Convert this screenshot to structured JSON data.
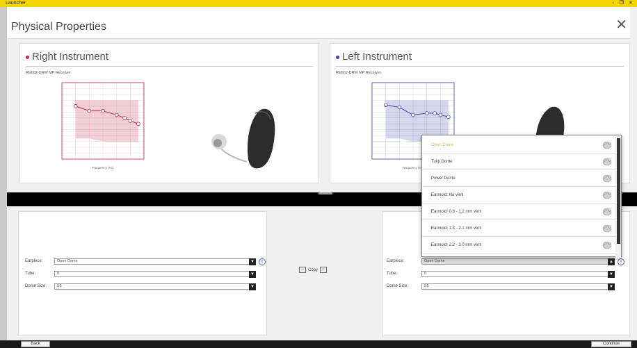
{
  "window": {
    "app_title": "Launcher",
    "controls": "- ❐ ×"
  },
  "header": {
    "title": "Physical Properties",
    "close_glyph": "✕"
  },
  "right_instrument": {
    "title": "Right Instrument",
    "color": "#c0254a",
    "receiver": "RE662-DRW MP Receiver",
    "chart_data": {
      "type": "line",
      "x": [
        250,
        500,
        1000,
        2000,
        3000,
        4000,
        6000
      ],
      "values": [
        30,
        38,
        38,
        45,
        50,
        55,
        60
      ],
      "xlabel": "Frequency (Hz)",
      "color": "#c0254a"
    }
  },
  "left_instrument": {
    "title": "Left Instrument",
    "color": "#3a46a8",
    "receiver": "RE662-DRW MP Receiver",
    "chart_data": {
      "type": "line",
      "x": [
        250,
        500,
        1000,
        2000,
        3000,
        4000,
        6000
      ],
      "values": [
        28,
        32,
        45,
        42,
        42,
        45,
        48
      ],
      "xlabel": "Frequency (Hz)",
      "color": "#3a46a8"
    }
  },
  "right_form": {
    "earpiece_label": "Earpiece:",
    "earpiece_value": "Open Dome",
    "tube_label": "Tube:",
    "tube_value": "0",
    "dome_label": "Dome Size:",
    "dome_value": "S5"
  },
  "left_form": {
    "earpiece_label": "Earpiece:",
    "earpiece_value": "Open Dome",
    "tube_label": "Tube:",
    "tube_value": "0",
    "dome_label": "Dome Size:",
    "dome_value": "S5"
  },
  "copy_label": "Copy",
  "earpiece_options": [
    {
      "label": "Open Dome",
      "selected": true
    },
    {
      "label": "Tulip Dome",
      "selected": false
    },
    {
      "label": "Power Dome",
      "selected": false
    },
    {
      "label": "Earmold: No vent",
      "selected": false
    },
    {
      "label": "Earmold: 0.6 - 1.2 mm vent",
      "selected": false
    },
    {
      "label": "Earmold: 1.3 - 2.1 mm vent",
      "selected": false
    },
    {
      "label": "Earmold: 2.2 - 3.0 mm vent",
      "selected": false
    }
  ],
  "footer": {
    "back_label": "Back",
    "continue_label": "Continue"
  }
}
